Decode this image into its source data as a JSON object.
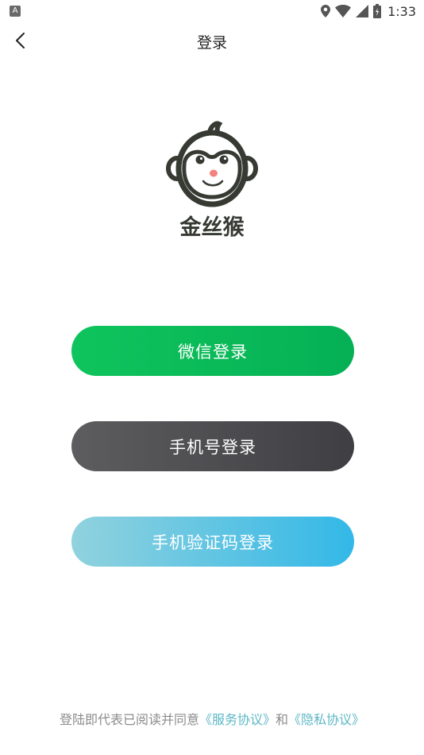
{
  "status_bar": {
    "left_icon_letter": "A",
    "left_icon": "a-notification-icon",
    "icons": [
      "location-icon",
      "wifi-icon",
      "signal-icon",
      "battery-icon"
    ],
    "time": "1:33"
  },
  "header": {
    "back_icon": "chevron-left-icon",
    "title": "登录"
  },
  "logo": {
    "name": "金丝猴",
    "icon": "monkey-face-logo"
  },
  "buttons": {
    "wechat_login": "微信登录",
    "phone_login": "手机号登录",
    "sms_login": "手机验证码登录"
  },
  "agreement": {
    "prefix": "登陆即代表已阅读并同意",
    "service_link": "《服务协议》",
    "joiner": "和",
    "privacy_link": "《隐私协议》"
  },
  "colors": {
    "wechat_green": "#0fc45c",
    "phone_dark": "#4e4e51",
    "sms_start": "#91d2de",
    "sms_end": "#33b8e7",
    "link": "#5db7c6"
  }
}
